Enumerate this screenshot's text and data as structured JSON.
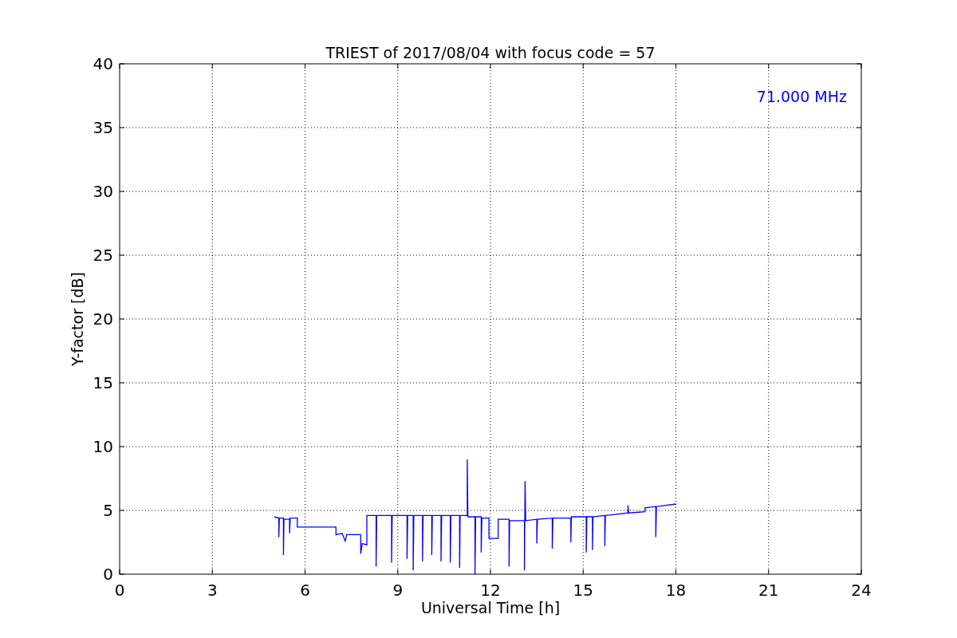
{
  "chart_data": {
    "type": "line",
    "title": "TRIEST of 2017/08/04 with focus code = 57",
    "xlabel": "Universal Time [h]",
    "ylabel": "Y-factor [dB]",
    "grid": true,
    "x": [
      5.0,
      5.15,
      5.15,
      5.17,
      5.3,
      5.3,
      5.32,
      5.5,
      5.5,
      5.52,
      5.75,
      5.75,
      7.0,
      7.0,
      7.2,
      7.3,
      7.35,
      7.8,
      7.8,
      7.85,
      8.0,
      8.0,
      8.3,
      8.3,
      8.32,
      8.8,
      8.8,
      8.82,
      9.3,
      9.3,
      9.32,
      9.5,
      9.5,
      9.52,
      9.8,
      9.8,
      9.82,
      10.1,
      10.1,
      10.12,
      10.4,
      10.4,
      10.42,
      10.7,
      10.7,
      10.72,
      11.0,
      11.0,
      11.02,
      11.25,
      11.25,
      11.27,
      11.5,
      11.5,
      11.52,
      11.7,
      11.7,
      11.72,
      11.95,
      11.95,
      12.25,
      12.25,
      12.6,
      12.6,
      12.62,
      13.1,
      13.1,
      13.12,
      13.14,
      13.5,
      13.5,
      13.52,
      14.0,
      14.0,
      14.02,
      14.6,
      14.6,
      14.62,
      15.1,
      15.1,
      15.12,
      15.3,
      15.3,
      15.32,
      15.7,
      15.7,
      15.72,
      16.45,
      16.45,
      16.47,
      17.0,
      17.0,
      17.35,
      17.35,
      17.37,
      18.0
    ],
    "series": [
      {
        "name": "71.000 MHz",
        "color": "#0000ff",
        "values": [
          4.5,
          4.4,
          2.9,
          4.4,
          4.4,
          1.5,
          4.3,
          4.3,
          3.2,
          4.4,
          4.4,
          3.7,
          3.7,
          3.1,
          3.2,
          2.6,
          3.1,
          3.1,
          1.6,
          2.4,
          2.3,
          4.6,
          4.6,
          0.6,
          4.6,
          4.6,
          0.9,
          4.6,
          4.6,
          1.2,
          4.6,
          4.6,
          0.3,
          4.6,
          4.6,
          1.0,
          4.6,
          4.6,
          1.5,
          4.6,
          4.6,
          1.0,
          4.6,
          4.6,
          0.9,
          4.6,
          4.6,
          0.5,
          4.6,
          4.6,
          9.0,
          4.5,
          4.5,
          0.0,
          4.5,
          4.5,
          1.7,
          4.4,
          4.4,
          2.8,
          2.8,
          4.3,
          4.3,
          0.6,
          4.2,
          4.2,
          0.3,
          7.3,
          4.2,
          4.3,
          2.4,
          4.3,
          4.4,
          2.0,
          4.4,
          4.4,
          2.5,
          4.5,
          4.5,
          1.7,
          4.5,
          4.5,
          1.9,
          4.5,
          4.6,
          2.2,
          4.6,
          4.8,
          5.4,
          4.8,
          4.9,
          5.2,
          5.3,
          2.9,
          5.3,
          5.5
        ]
      }
    ],
    "xlim": [
      0,
      24
    ],
    "ylim": [
      0,
      40
    ],
    "xticks": [
      0,
      3,
      6,
      9,
      12,
      15,
      18,
      21,
      24
    ],
    "yticks": [
      0,
      5,
      10,
      15,
      20,
      25,
      30,
      35,
      40
    ]
  }
}
